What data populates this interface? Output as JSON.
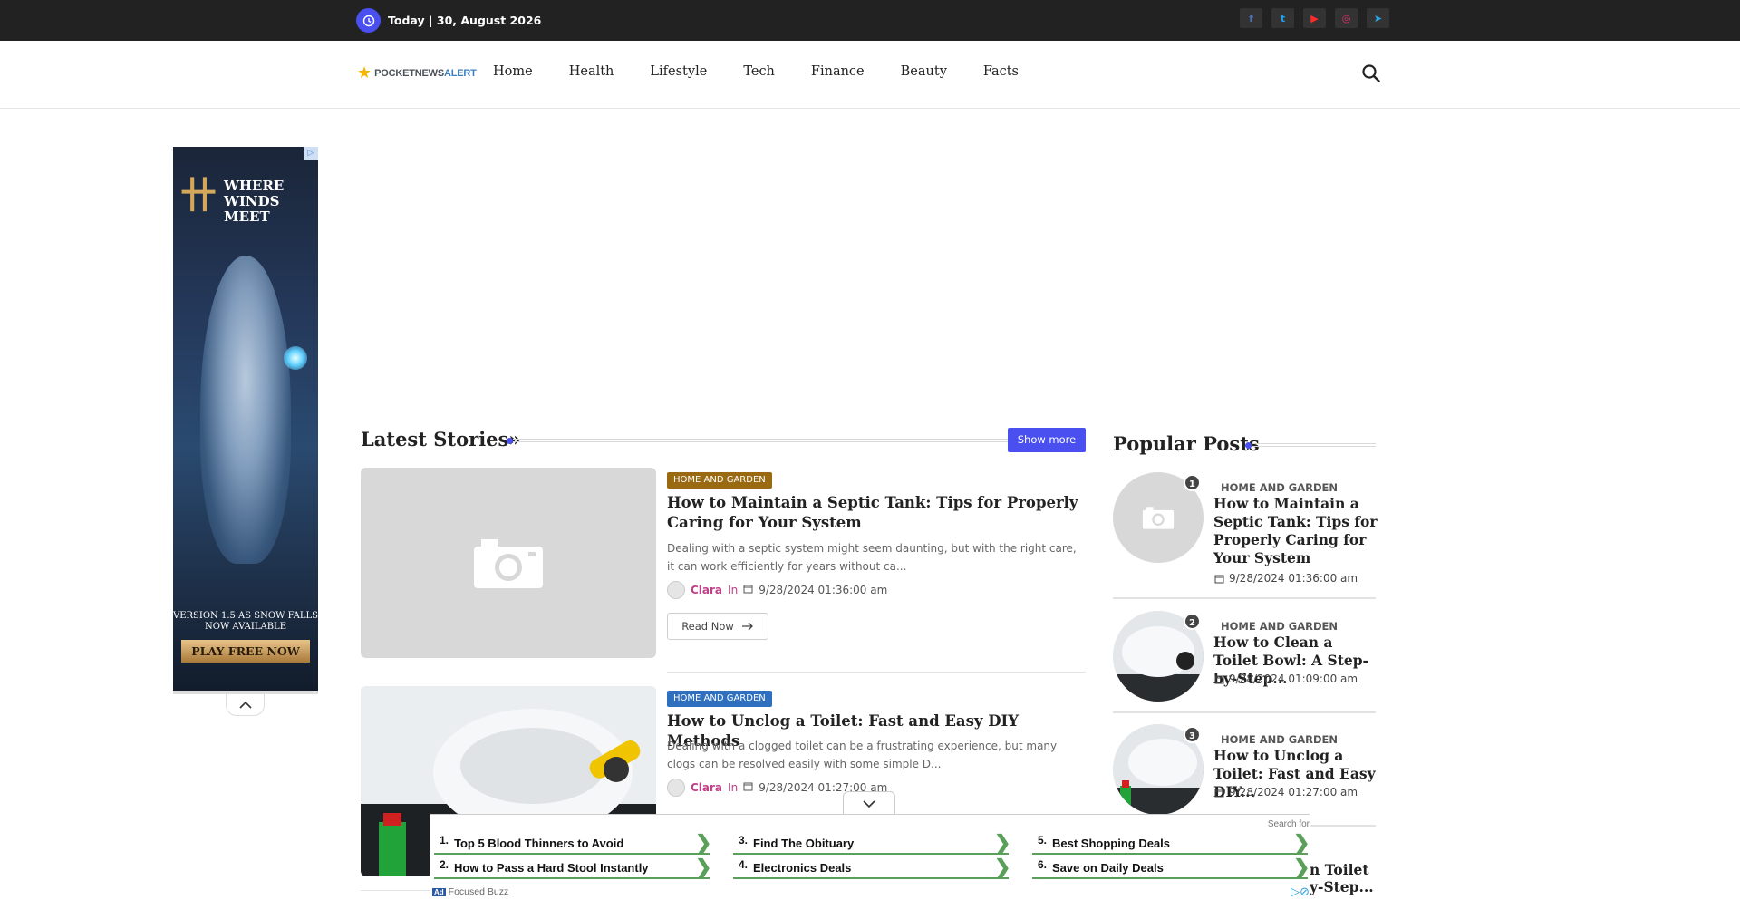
{
  "topbar": {
    "date": "Today | 30, August 2026",
    "socials": [
      {
        "icon": "facebook-icon",
        "glyph": "f",
        "color": "#3b5998"
      },
      {
        "icon": "twitter-icon",
        "glyph": "t",
        "color": "#1da1f2"
      },
      {
        "icon": "youtube-icon",
        "glyph": "▶",
        "color": "#ff0000"
      },
      {
        "icon": "instagram-icon",
        "glyph": "◎",
        "color": "#e1306c"
      },
      {
        "icon": "telegram-icon",
        "glyph": "➤",
        "color": "#29a9eb"
      }
    ]
  },
  "header": {
    "logo_part1": "POCKETNEWS",
    "logo_part2": "ALERT",
    "nav": [
      "Home",
      "Health",
      "Lifestyle",
      "Tech",
      "Finance",
      "Beauty",
      "Facts"
    ]
  },
  "left_ad": {
    "logo_mark": "卄",
    "title": "WHERE WINDS MEET",
    "subtitle": "VERSION 1.5 AS SNOW FALLS NOW AVAILABLE",
    "cta": "PLAY FREE NOW"
  },
  "latest": {
    "title": "Latest Stories»",
    "show_more": "Show more",
    "read_now": "Read Now",
    "in_label": "In",
    "stories": [
      {
        "category": "HOME AND GARDEN",
        "category_color": "#9a6a12",
        "title": "How to Maintain a Septic Tank: Tips for Properly Caring for Your System",
        "desc": "Dealing with a septic system might seem daunting, but with the right care, it can work efficiently for years without ca...",
        "author": "Clara",
        "date": "9/28/2024 01:36:00 am"
      },
      {
        "category": "HOME AND GARDEN",
        "category_color": "#2f6fbf",
        "title": "How to Unclog a Toilet: Fast and Easy DIY Methods",
        "desc": "Dealing with a clogged toilet can be a frustrating experience, but many clogs can be resolved easily with some simple D...",
        "author": "Clara",
        "date": "9/28/2024 01:27:00 am"
      }
    ]
  },
  "popular": {
    "title": "Popular Posts",
    "posts": [
      {
        "num": "1",
        "category": "HOME AND GARDEN",
        "title": "How to Maintain a Septic Tank: Tips for Properly Caring for Your System",
        "date": "9/28/2024 01:36:00 am"
      },
      {
        "num": "2",
        "category": "HOME AND GARDEN",
        "title": "How to Clean a Toilet Bowl: A Step-by-Step...",
        "date": "9/28/2024 01:09:00 am"
      },
      {
        "num": "3",
        "category": "HOME AND GARDEN",
        "title": "How to Unclog a Toilet: Fast and Easy DIY...",
        "date": "9/28/2024 01:27:00 am"
      }
    ],
    "peek_line1": "n Toilet",
    "peek_line2": "y-Step..."
  },
  "bottom_ad": {
    "search_for": "Search for",
    "items": [
      {
        "num": "1.",
        "text": "Top 5 Blood Thinners to Avoid"
      },
      {
        "num": "2.",
        "text": "How to Pass a Hard Stool Instantly"
      },
      {
        "num": "3.",
        "text": "Find The Obituary"
      },
      {
        "num": "4.",
        "text": "Electronics Deals"
      },
      {
        "num": "5.",
        "text": "Best Shopping Deals"
      },
      {
        "num": "6.",
        "text": "Save on Daily Deals"
      }
    ],
    "ad_label": "Ad",
    "brand": "Focused Buzz"
  }
}
